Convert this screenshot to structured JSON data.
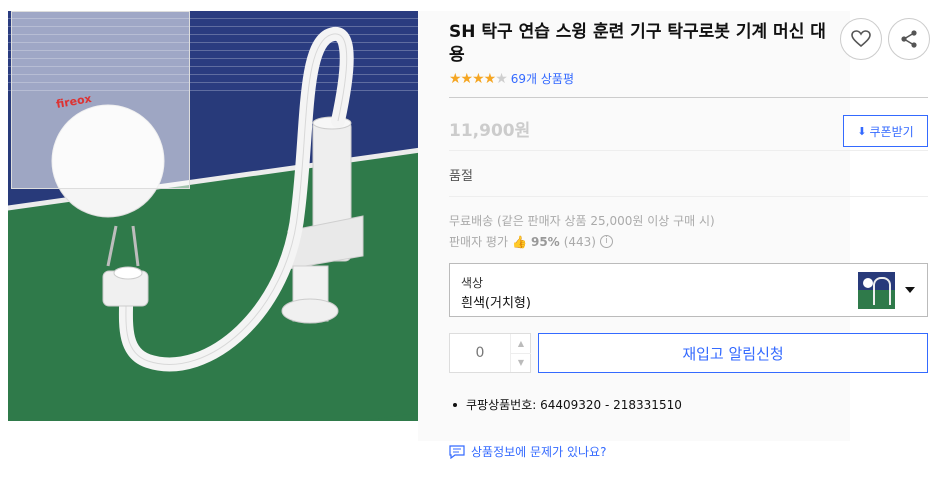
{
  "product": {
    "title": "SH 탁구 연습 스윙 훈련 기구 탁구로봇 기계 머신 대용",
    "rating_stars": 4,
    "rating_max": 5,
    "review_count_label": "69개 상품평",
    "price": "11,900원",
    "coupon_label": "쿠폰받기",
    "status": "품절",
    "shipping": "무료배송 (같은 판매자 상품 25,000원 이상 구매 시)",
    "seller_rating_label": "판매자 평가",
    "seller_rating_pct": "95%",
    "seller_rating_count": "(443)",
    "product_number": "쿠팡상품번호: 64409320 - 218331510",
    "report_link": "상품정보에 문제가 있나요?"
  },
  "option": {
    "label": "색상",
    "value": "흰색(거치형)"
  },
  "quantity": {
    "value": "0"
  },
  "restock_button": "재입고 알림신청",
  "image_text": {
    "ball_brand": "fireox"
  },
  "colors": {
    "accent_blue": "#346aff",
    "star": "#f5a623"
  }
}
